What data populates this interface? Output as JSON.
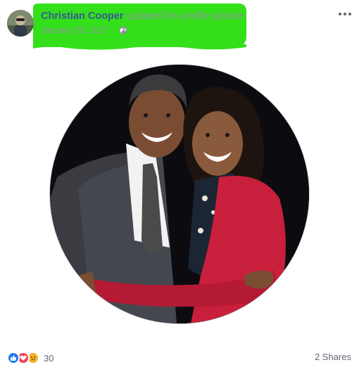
{
  "post": {
    "author": "Christian Cooper",
    "action": "updated his profile picture.",
    "date": "January 20, 2017",
    "separator": "·",
    "privacy_icon": "globe-icon",
    "menu_icon": "more-options-icon"
  },
  "photo": {
    "description_icon": "profile-photo"
  },
  "footer": {
    "reaction_icons": [
      "like-icon",
      "love-icon",
      "sad-icon"
    ],
    "reaction_count": "30",
    "shares": "2 Shares"
  },
  "colors": {
    "highlight": "#33e01a",
    "link": "#385898",
    "muted": "#8d949e",
    "like": "#1877f2",
    "love": "#f33e58",
    "sad": "#f7b125"
  }
}
